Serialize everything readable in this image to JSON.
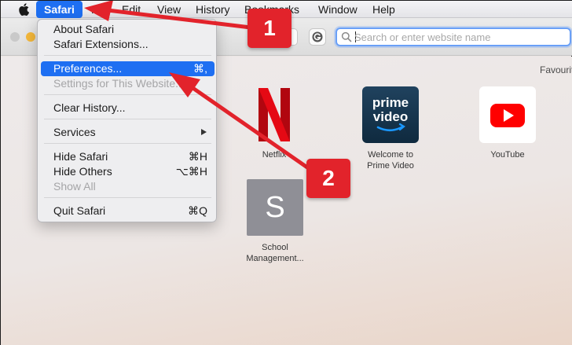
{
  "menubar": {
    "app": "Safari",
    "items": [
      "File",
      "Edit",
      "View",
      "History",
      "Bookmarks",
      "Window",
      "Help"
    ]
  },
  "address_bar": {
    "placeholder": "Search or enter website name"
  },
  "favourites": {
    "heading": "Favourites",
    "items": [
      {
        "label": "Netflix",
        "icon": "netflix-icon"
      },
      {
        "label": "Welcome to Prime Video",
        "label_line1": "Welcome to",
        "label_line2": "Prime Video",
        "logo_line1": "prime",
        "logo_line2": "video",
        "icon": "prime-video-icon"
      },
      {
        "label": "YouTube",
        "icon": "youtube-icon"
      },
      {
        "label": "School Management...",
        "label_line1": "School",
        "label_line2": "Management...",
        "logo_letter": "S",
        "icon": "school-icon"
      }
    ]
  },
  "safari_menu": {
    "items": [
      {
        "label": "About Safari"
      },
      {
        "label": "Safari Extensions..."
      },
      {
        "label": "Preferences...",
        "shortcut": "⌘,",
        "highlighted": true
      },
      {
        "label": "Settings for This Website...",
        "disabled": true
      },
      {
        "label": "Clear History..."
      },
      {
        "label": "Services",
        "submenu": true
      },
      {
        "label": "Hide Safari",
        "shortcut": "⌘H"
      },
      {
        "label": "Hide Others",
        "shortcut": "⌥⌘H"
      },
      {
        "label": "Show All",
        "disabled": true
      },
      {
        "label": "Quit Safari",
        "shortcut": "⌘Q"
      }
    ]
  },
  "annotations": {
    "step1": "1",
    "step2": "2",
    "color": "#e2232b"
  },
  "colors": {
    "menu_highlight": "#1e6ff2",
    "traffic_yellow": "#f5b83a"
  }
}
